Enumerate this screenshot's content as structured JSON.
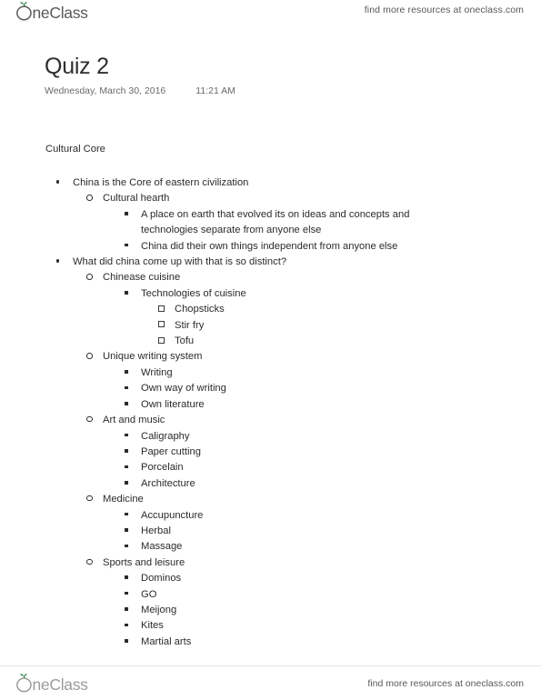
{
  "brand": {
    "name": "OneClass",
    "logo_icon": "oneclass-sprout-logo",
    "accent_green": "#2f8f54",
    "wordmark_color": "#58595b"
  },
  "header": {
    "tagline": "find more resources at oneclass.com"
  },
  "footer": {
    "tagline": "find more resources at oneclass.com"
  },
  "title_block": {
    "title": "Quiz 2",
    "date": "Wednesday, March 30, 2016",
    "time": "11:21 AM"
  },
  "body": {
    "section_heading": "Cultural Core",
    "outline": [
      {
        "level": 1,
        "bullet": "disc",
        "text": "China is the Core of eastern civilization"
      },
      {
        "level": 2,
        "bullet": "circle",
        "text": "Cultural hearth"
      },
      {
        "level": 3,
        "bullet": "square",
        "text": "A place on earth that evolved its on ideas and concepts and technologies separate from anyone else"
      },
      {
        "level": 3,
        "bullet": "square",
        "text": "China did their own things independent from anyone else"
      },
      {
        "level": 1,
        "bullet": "disc",
        "text": "What did china come up with that is so distinct?"
      },
      {
        "level": 2,
        "bullet": "circle",
        "text": "Chinease cuisine"
      },
      {
        "level": 3,
        "bullet": "square",
        "text": "Technologies of cuisine"
      },
      {
        "level": 4,
        "bullet": "hollow-square",
        "text": "Chopsticks"
      },
      {
        "level": 4,
        "bullet": "hollow-square",
        "text": "Stir fry"
      },
      {
        "level": 4,
        "bullet": "hollow-square",
        "text": "Tofu"
      },
      {
        "level": 2,
        "bullet": "circle",
        "text": "Unique writing system"
      },
      {
        "level": 3,
        "bullet": "square",
        "text": "Writing"
      },
      {
        "level": 3,
        "bullet": "square",
        "text": "Own way of writing"
      },
      {
        "level": 3,
        "bullet": "square",
        "text": "Own literature"
      },
      {
        "level": 2,
        "bullet": "circle",
        "text": "Art and music"
      },
      {
        "level": 3,
        "bullet": "square",
        "text": "Caligraphy"
      },
      {
        "level": 3,
        "bullet": "square",
        "text": "Paper cutting"
      },
      {
        "level": 3,
        "bullet": "square",
        "text": "Porcelain"
      },
      {
        "level": 3,
        "bullet": "square",
        "text": "Architecture"
      },
      {
        "level": 2,
        "bullet": "circle",
        "text": "Medicine"
      },
      {
        "level": 3,
        "bullet": "square",
        "text": "Accupuncture"
      },
      {
        "level": 3,
        "bullet": "square",
        "text": "Herbal"
      },
      {
        "level": 3,
        "bullet": "square",
        "text": "Massage"
      },
      {
        "level": 2,
        "bullet": "circle",
        "text": "Sports and leisure"
      },
      {
        "level": 3,
        "bullet": "square",
        "text": "Dominos"
      },
      {
        "level": 3,
        "bullet": "square",
        "text": "GO"
      },
      {
        "level": 3,
        "bullet": "square",
        "text": "Meijong"
      },
      {
        "level": 3,
        "bullet": "square",
        "text": "Kites"
      },
      {
        "level": 3,
        "bullet": "square",
        "text": "Martial arts"
      }
    ]
  }
}
